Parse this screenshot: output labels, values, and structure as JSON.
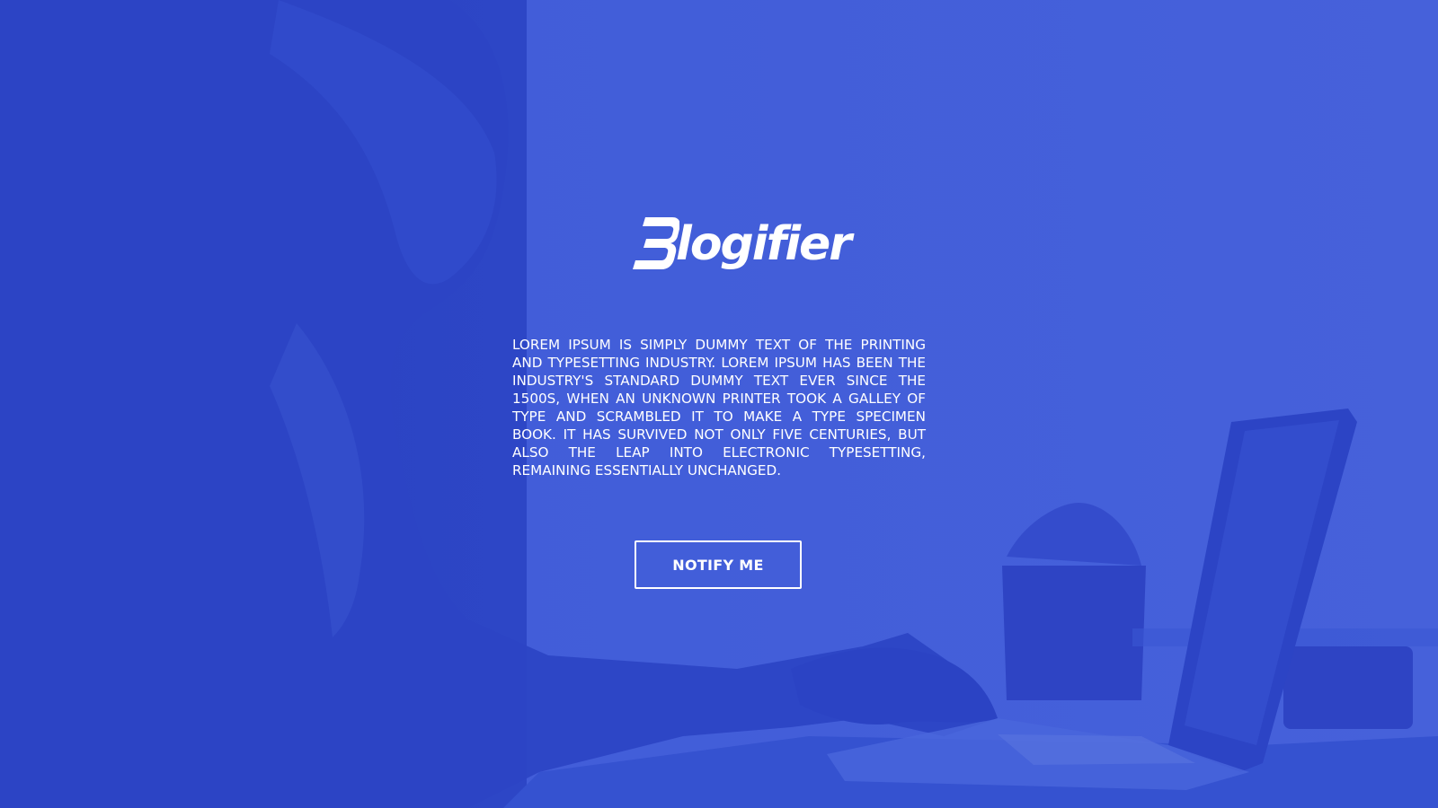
{
  "brand": {
    "name": "Blogifier"
  },
  "hero": {
    "description": "Lorem Ipsum is simply dummy text of the printing and typesetting industry. Lorem Ipsum has been the industry's standard dummy text ever since the 1500s, when an unknown printer took a galley of type and scrambled it to make a type specimen book. It has survived not only five centuries, but also the leap into electronic typesetting, remaining essentially unchanged.",
    "button_label": "NOTIFY ME"
  },
  "theme": {
    "background": "#3f5bd8",
    "overlay_dark": "#2b43c4",
    "text": "#ffffff"
  },
  "icons": {
    "logo_mark": "b-logo-mark-icon"
  }
}
